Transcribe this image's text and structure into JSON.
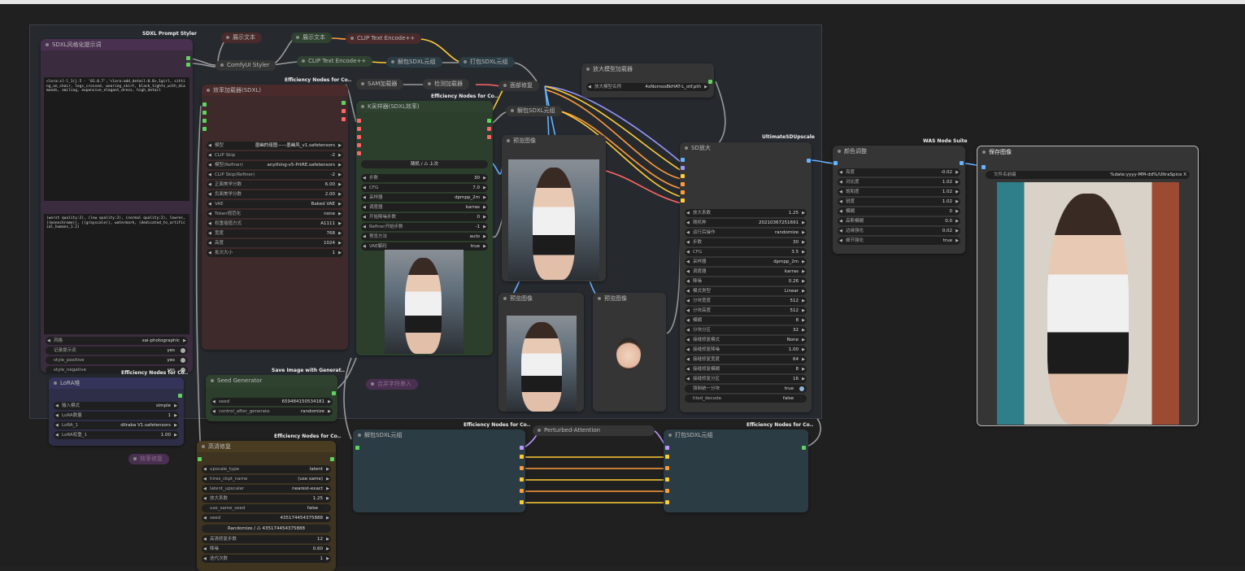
{
  "colors": {
    "bg": "#202020",
    "group": "#262a2f",
    "purple": "#4a3050",
    "red": "#4a2a2a",
    "green": "#2f4230",
    "dark_teal": "#2c3c44",
    "yellow": "#4a3c20",
    "navy": "#2e2e48"
  },
  "group": {
    "title": "SDXL Prompt Styler"
  },
  "styler": {
    "title": "SDXL风格化提示词",
    "positive": "<lora:xl-l_1(j.5 - '01.0.7','<lora:add_detail:0.8>,1girl, sitting_on_chair, legs_crossed, wearing_skirt, black_tights_with_diamonds, smiling, expensive_elegant_dress, high_detail",
    "negative": "(worst quality:2), (low quality:2), (normal quality:2), lowres, ((monochrome)), ((grayscale)), watermark, (dedicated_to_artificial_humans_1.2)",
    "widgets": [
      {
        "label": "风格",
        "value": "sai-photographic"
      },
      {
        "label": "记录提示词",
        "value": "yes"
      },
      {
        "label": "style_positive",
        "value": "yes"
      },
      {
        "label": "style_negative",
        "value": "yes"
      }
    ]
  },
  "show_text_1": {
    "title": "展示文本"
  },
  "show_text_2": {
    "title": "展示文本"
  },
  "comfy_styler": {
    "title": "ComfyUI Styler"
  },
  "clip_enc_1": {
    "title": "CLIP Text Encode++"
  },
  "clip_enc_2": {
    "title": "CLIP Text Encode++"
  },
  "unpack_1": {
    "title": "解包SDXL元组"
  },
  "pack_1": {
    "title": "打包SDXL元组"
  },
  "sam": {
    "title": "SAM加载器"
  },
  "detect": {
    "title": "检测加载器"
  },
  "face_fix": {
    "title": "面部修复"
  },
  "unpack_2": {
    "title": "解包SDXL元组"
  },
  "upscale_loader": {
    "title": "放大模型加载器",
    "widget": {
      "label": "放大模型名称",
      "value": "4xNomos8kHAT-L_otf.pth"
    }
  },
  "eff_loader": {
    "tag": "Efficiency Nodes for Co..",
    "title": "效率加载器(SDXL)",
    "widgets": [
      {
        "label": "模型",
        "value": "墨幽的组图——墨幽风_v1.safetensors"
      },
      {
        "label": "CLIP Skip",
        "value": "-2"
      },
      {
        "label": "模型(Refiner)",
        "value": "anything-v5-PrtRE.safetensors"
      },
      {
        "label": "CLIP Skip(Refiner)",
        "value": "-2"
      },
      {
        "label": "正面美学分数",
        "value": "6.00"
      },
      {
        "label": "负面美学分数",
        "value": "2.00"
      },
      {
        "label": "VAE",
        "value": "Baked VAE"
      },
      {
        "label": "Token规范化",
        "value": "none"
      },
      {
        "label": "权重插值方式",
        "value": "A1111"
      },
      {
        "label": "宽度",
        "value": "768"
      },
      {
        "label": "高度",
        "value": "1024"
      },
      {
        "label": "批次大小",
        "value": "1"
      }
    ]
  },
  "ksampler": {
    "tag": "Efficiency Nodes for Co..",
    "title": "K采样器(SDXL效率)",
    "seed_btn": "随机 / ♺ 上次",
    "widgets": [
      {
        "label": "步数",
        "value": "30"
      },
      {
        "label": "CFG",
        "value": "7.0"
      },
      {
        "label": "采样器",
        "value": "dpmpp_2m"
      },
      {
        "label": "调度器",
        "value": "karras"
      },
      {
        "label": "开始降噪步数",
        "value": "0"
      },
      {
        "label": "Refiner开始步数",
        "value": "-1"
      },
      {
        "label": "预览方法",
        "value": "auto"
      },
      {
        "label": "VAE解码",
        "value": "true"
      }
    ]
  },
  "preview_1": {
    "title": "预览图像"
  },
  "preview_2": {
    "title": "预览图像"
  },
  "preview_3": {
    "title": "预览图像"
  },
  "sd_upscale": {
    "tag": "UltimateSDUpscale",
    "title": "SD放大",
    "widgets": [
      {
        "label": "放大系数",
        "value": "1.25"
      },
      {
        "label": "随机种",
        "value": "20210367251691"
      },
      {
        "label": "运行后操作",
        "value": "randomize"
      },
      {
        "label": "步数",
        "value": "30"
      },
      {
        "label": "CFG",
        "value": "3.5"
      },
      {
        "label": "采样器",
        "value": "dpmpp_2m"
      },
      {
        "label": "调度器",
        "value": "karras"
      },
      {
        "label": "降噪",
        "value": "0.26"
      },
      {
        "label": "模式类型",
        "value": "Linear"
      },
      {
        "label": "分块宽度",
        "value": "512"
      },
      {
        "label": "分块高度",
        "value": "512"
      },
      {
        "label": "模糊",
        "value": "8"
      },
      {
        "label": "分块分区",
        "value": "32"
      },
      {
        "label": "接缝修复模式",
        "value": "None"
      },
      {
        "label": "接缝修复降噪",
        "value": "1.00"
      },
      {
        "label": "接缝修复宽度",
        "value": "64"
      },
      {
        "label": "接缝修复模糊",
        "value": "8"
      },
      {
        "label": "接缝修复分区",
        "value": "16"
      }
    ],
    "toggles": [
      {
        "label": "强制统一分块",
        "value": "true"
      },
      {
        "label": "tiled_decode",
        "value": "false"
      }
    ]
  },
  "color_adjust": {
    "tag": "WAS Node Suite",
    "title": "颜色调整",
    "widgets": [
      {
        "label": "亮度",
        "value": "-0.02"
      },
      {
        "label": "对比度",
        "value": "1.02"
      },
      {
        "label": "饱和度",
        "value": "1.02"
      },
      {
        "label": "锐度",
        "value": "1.02"
      },
      {
        "label": "模糊",
        "value": "0"
      },
      {
        "label": "高斯模糊",
        "value": "0.0"
      },
      {
        "label": "边缘强化",
        "value": "0.02"
      },
      {
        "label": "细节强化",
        "value": "true"
      }
    ]
  },
  "save_image": {
    "title": "保存图像",
    "filename_label": "文件名前缀",
    "filename_value": "%date:yyyy-MM-dd%/UltraSpice X"
  },
  "lora": {
    "tag": "Efficiency Nodes for Co..",
    "title": "LoRA堆",
    "widgets": [
      {
        "label": "输入模式",
        "value": "simple"
      },
      {
        "label": "LoRA数量",
        "value": "1"
      },
      {
        "label": "LoRA_1",
        "value": "dilraba V1.safetensors"
      },
      {
        "label": "LoRA权重_1",
        "value": "1.00"
      }
    ]
  },
  "seed_gen": {
    "tag": "Save Image with Generat..",
    "title": "Seed Generator",
    "widgets": [
      {
        "label": "seed",
        "value": "659484150534181"
      },
      {
        "label": "control_after_generate",
        "value": "randomize"
      }
    ]
  },
  "collapsed_1": {
    "title": "合并字符串入"
  },
  "collapsed_2": {
    "title": "效率修复"
  },
  "hires": {
    "tag": "Efficiency Nodes for Co..",
    "title": "高清修复",
    "widgets_a": [
      {
        "label": "upscale_type",
        "value": "latent"
      },
      {
        "label": "hires_ckpt_name",
        "value": "(use same)"
      },
      {
        "label": "latent_upscaler",
        "value": "nearest-exact"
      },
      {
        "label": "放大系数",
        "value": "1.25"
      }
    ],
    "toggle": {
      "label": "use_same_seed",
      "value": "false"
    },
    "seed": {
      "label": "seed",
      "value": "435174454375888"
    },
    "rand_btn": "Randomize / ♺ 435174454375888",
    "widgets_b": [
      {
        "label": "高清修复步数",
        "value": "12"
      },
      {
        "label": "降噪",
        "value": "0.60"
      },
      {
        "label": "迭代次数",
        "value": "1"
      }
    ]
  },
  "unpack_3": {
    "tag": "Efficiency Nodes for Co..",
    "title": "解包SDXL元组"
  },
  "pag": {
    "title": "Perturbed-Attention"
  },
  "pack_2": {
    "tag": "Efficiency Nodes for Co..",
    "title": "打包SDXL元组"
  }
}
